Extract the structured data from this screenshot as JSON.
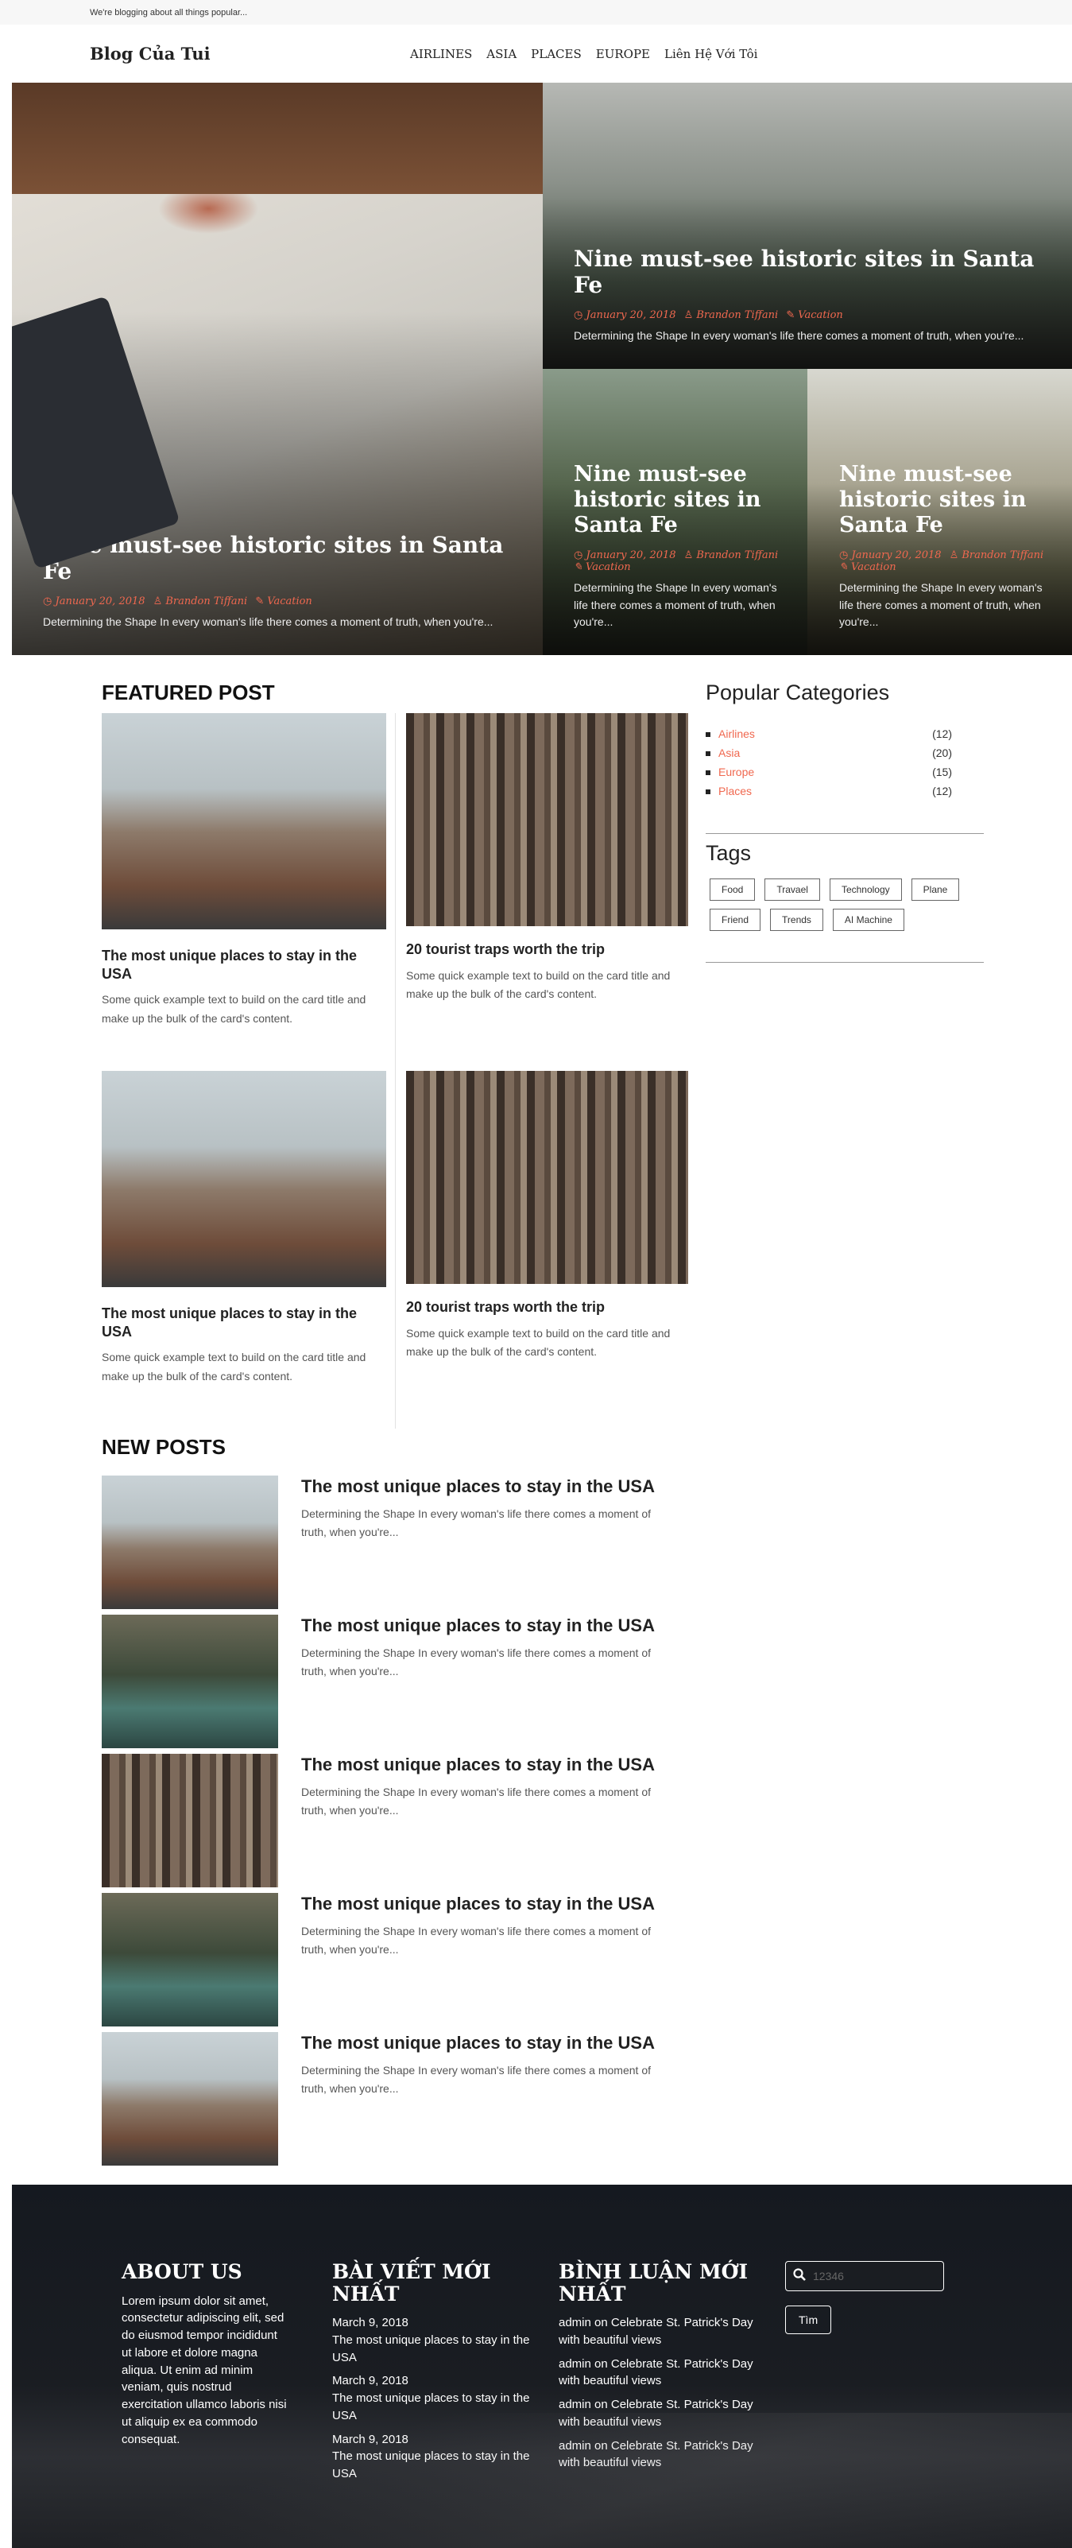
{
  "topbar": {
    "text": "We're blogging about all things popular..."
  },
  "nav": {
    "brand": "Blog Của Tui",
    "items": [
      "AIRLINES",
      "ASIA",
      "PLACES",
      "EUROPE",
      "Liên Hệ Với Tôi"
    ]
  },
  "hero": [
    {
      "title": "Nine must-see historic sites in Santa Fe",
      "date": "January 20, 2018",
      "author": "Brandon Tiffani",
      "category": "Vacation",
      "excerpt": "Determining the Shape In every woman's life there comes a moment of truth, when you're..."
    },
    {
      "title": "Nine must-see historic sites in Santa Fe",
      "date": "January 20, 2018",
      "author": "Brandon Tiffani",
      "category": "Vacation",
      "excerpt": "Determining the Shape In every woman's life there comes a moment of truth, when you're..."
    },
    {
      "title": "Nine must-see historic sites in Santa Fe",
      "date": "January 20, 2018",
      "author": "Brandon Tiffani",
      "category": "Vacation",
      "excerpt": "Determining the Shape In every woman's life there comes a moment of truth, when you're..."
    },
    {
      "title": "Nine must-see historic sites in Santa Fe",
      "date": "January 20, 2018",
      "author": "Brandon Tiffani",
      "category": "Vacation",
      "excerpt": "Determining the Shape In every woman's life there comes a moment of truth, when you're..."
    }
  ],
  "featured": {
    "title": "FEATURED POST",
    "posts": [
      {
        "title": "The most unique places to stay in the USA",
        "text": "Some quick example text to build on the card title and make up the bulk of the card's content."
      },
      {
        "title": "20 tourist traps worth the trip",
        "text": "Some quick example text to build on the card title and make up the bulk of the card's content."
      },
      {
        "title": "The most unique places to stay in the USA",
        "text": "Some quick example text to build on the card title and make up the bulk of the card's content."
      },
      {
        "title": "20 tourist traps worth the trip",
        "text": "Some quick example text to build on the card title and make up the bulk of the card's content."
      }
    ]
  },
  "sidebar": {
    "categories_title": "Popular Categories",
    "categories": [
      {
        "name": "Airlines",
        "count": "(12)"
      },
      {
        "name": "Asia",
        "count": "(20)"
      },
      {
        "name": "Europe",
        "count": "(15)"
      },
      {
        "name": "Places",
        "count": "(12)"
      }
    ],
    "tags_title": "Tags",
    "tags": [
      "Food",
      "Travael",
      "Technology",
      "Plane",
      "Friend",
      "Trends",
      "AI Machine"
    ]
  },
  "new_posts": {
    "title": "NEW POSTS",
    "items": [
      {
        "title": "The most unique places to stay in the USA",
        "excerpt": "Determining the Shape In every woman's life there comes a moment of truth, when you're..."
      },
      {
        "title": "The most unique places to stay in the USA",
        "excerpt": "Determining the Shape In every woman's life there comes a moment of truth, when you're..."
      },
      {
        "title": "The most unique places to stay in the USA",
        "excerpt": "Determining the Shape In every woman's life there comes a moment of truth, when you're..."
      },
      {
        "title": "The most unique places to stay in the USA",
        "excerpt": "Determining the Shape In every woman's life there comes a moment of truth, when you're..."
      },
      {
        "title": "The most unique places to stay in the USA",
        "excerpt": "Determining the Shape In every woman's life there comes a moment of truth, when you're..."
      }
    ]
  },
  "footer": {
    "about_title": "ABOUT US",
    "about_text": "Lorem ipsum dolor sit amet, consectetur adipiscing elit, sed do eiusmod tempor incididunt ut labore et dolore magna aliqua. Ut enim ad minim veniam, quis nostrud exercitation ullamco laboris nisi ut aliquip ex ea commodo consequat.",
    "recent_title": "BÀI VIẾT MỚI NHẤT",
    "recent": [
      {
        "date": "March 9, 2018",
        "title": "The most unique places to stay in the USA"
      },
      {
        "date": "March 9, 2018",
        "title": "The most unique places to stay in the USA"
      },
      {
        "date": "March 9, 2018",
        "title": "The most unique places to stay in the USA"
      }
    ],
    "comments_title": "BÌNH LUẬN MỚI NHẤT",
    "comments": [
      "admin on Celebrate St. Patrick's Day with beautiful views",
      "admin on Celebrate St. Patrick's Day with beautiful views",
      "admin on Celebrate St. Patrick's Day with beautiful views",
      "admin on Celebrate St. Patrick's Day with beautiful views"
    ],
    "search_placeholder": "12346",
    "search_button": "Tìm"
  },
  "colors": {
    "accent": "#f0684f",
    "footer_bg": "#151920"
  }
}
